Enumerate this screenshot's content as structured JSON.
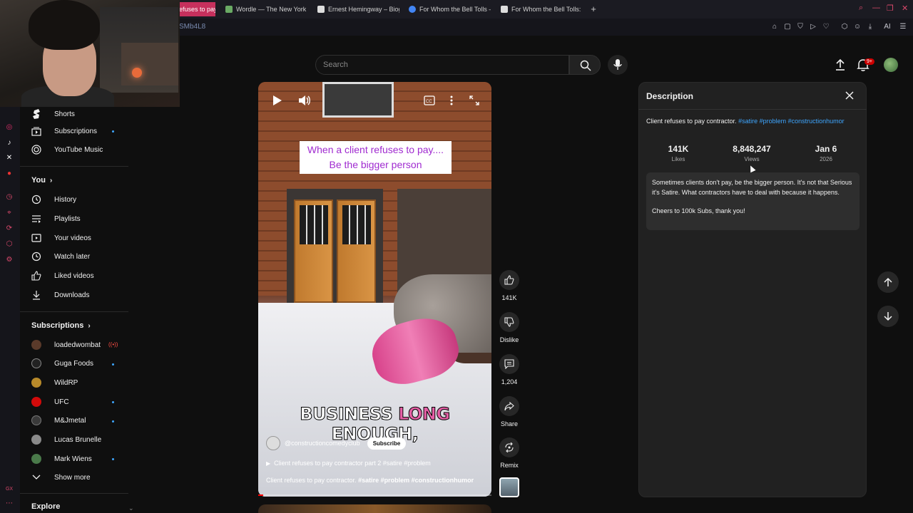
{
  "browser": {
    "tabs": [
      {
        "label": "efuses to pay",
        "active": true,
        "color": "#c6305d"
      },
      {
        "label": "Wordle — The New York T",
        "color": "#6aaa64"
      },
      {
        "label": "Ernest Hemingway – Biogr",
        "color": "#dddddd"
      },
      {
        "label": "For Whom the Bell Tolls –",
        "color": "#4285f4"
      },
      {
        "label": "For Whom the Bell Tolls: H",
        "color": "#dddddd"
      }
    ],
    "new_tab": "+",
    "url": "SMb4L8",
    "extensions_label": "AI"
  },
  "header": {
    "search_placeholder": "Search",
    "notification_count": "9+"
  },
  "sidebar": {
    "top_items": [
      {
        "label": "Shorts",
        "icon": "shorts-icon"
      },
      {
        "label": "Subscriptions",
        "icon": "subscriptions-icon",
        "dot": true
      },
      {
        "label": "YouTube Music",
        "icon": "youtube-music-icon"
      }
    ],
    "you_heading": "You",
    "you_items": [
      {
        "label": "History",
        "icon": "history-icon"
      },
      {
        "label": "Playlists",
        "icon": "playlists-icon"
      },
      {
        "label": "Your videos",
        "icon": "your-videos-icon"
      },
      {
        "label": "Watch later",
        "icon": "watch-later-icon"
      },
      {
        "label": "Liked videos",
        "icon": "liked-videos-icon"
      },
      {
        "label": "Downloads",
        "icon": "downloads-icon"
      }
    ],
    "subs_heading": "Subscriptions",
    "channels": [
      {
        "label": "loadedwombat",
        "live": true,
        "color": "#5a3a2a"
      },
      {
        "label": "Guga Foods",
        "dot": true,
        "color": "#222222"
      },
      {
        "label": "WildRP",
        "color": "#b88a2a"
      },
      {
        "label": "UFC",
        "dot": true,
        "color": "#d20a0a"
      },
      {
        "label": "M&Jmetal",
        "dot": true,
        "color": "#3a3a3a"
      },
      {
        "label": "Lucas Brunelle",
        "color": "#8a8a8a"
      },
      {
        "label": "Mark Wiens",
        "dot": true,
        "color": "#4a7a4a"
      }
    ],
    "show_more": "Show more",
    "explore_heading": "Explore"
  },
  "video": {
    "overlay_caption_line1": "When a client refuses to pay....",
    "overlay_caption_line2": "Be the bigger person",
    "big_caption_part1": "BUSINESS ",
    "big_caption_highlight": "LONG",
    "big_caption_part2": " ENOUGH,",
    "channel_handle": "@constructioncomedyclub",
    "subscribe_label": "Subscribe",
    "playlist_text": "Client refuses to pay contractor part 2 #satire #problem",
    "title_plain": "Client refuses to pay contractor. ",
    "title_tags": "#satire #problem #constructionhumor",
    "progress_fraction": 0.02
  },
  "actions": {
    "like_count": "141K",
    "dislike_label": "Dislike",
    "comment_count": "1,204",
    "share_label": "Share",
    "remix_label": "Remix"
  },
  "description": {
    "title": "Description",
    "summary_plain": "Client refuses to pay contractor. ",
    "summary_tags": "#satire #problem #constructionhumor",
    "stats": [
      {
        "value": "141K",
        "label": "Likes"
      },
      {
        "value": "8,848,247",
        "label": "Views"
      },
      {
        "value": "Jan 6",
        "label": "2026"
      }
    ],
    "body_line1": "Sometimes clients don't pay, be the bigger person.  It's not that Serious it's Satire. What contractors have to deal with because it happens.",
    "body_line2": "Cheers to 100k Subs, thank you!"
  },
  "colors": {
    "accent_link": "#3ea6ff",
    "notification_red": "#cc0000",
    "caption_purple": "#a02bd0",
    "caption_pink": "#e55ea5"
  }
}
